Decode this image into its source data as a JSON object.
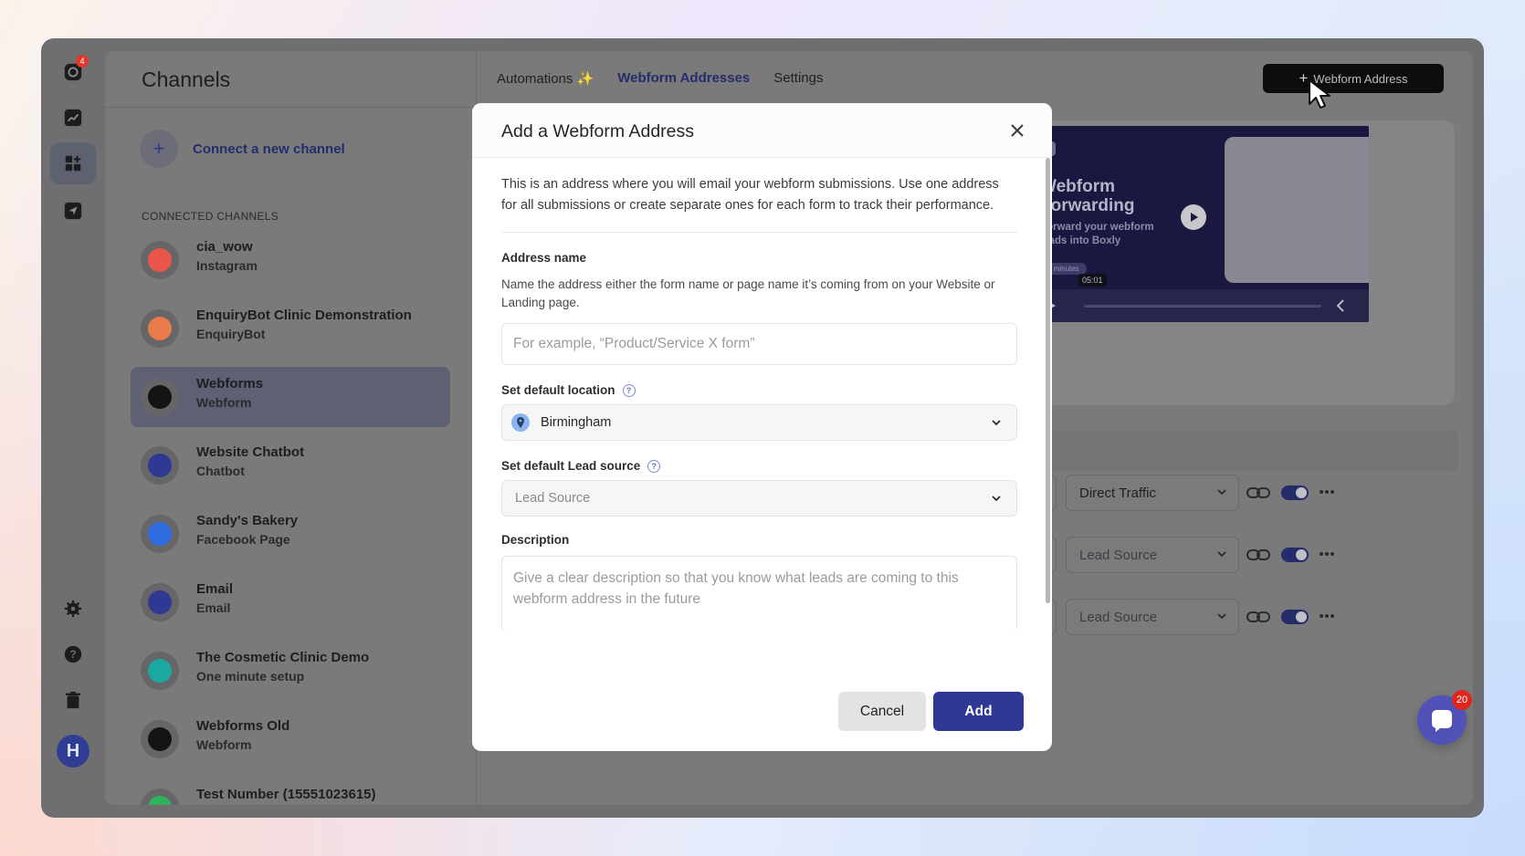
{
  "rail": {
    "badge": "4",
    "avatar_initial": "H"
  },
  "channels": {
    "title": "Channels",
    "connect_label": "Connect a new channel",
    "section_label": "CONNECTED CHANNELS",
    "items": [
      {
        "name": "cia_wow",
        "type": "Instagram",
        "color": "#e8574a"
      },
      {
        "name": "EnquiryBot Clinic Demonstration",
        "type": "EnquiryBot",
        "color": "#e97a4a"
      },
      {
        "name": "Webforms",
        "type": "Webform",
        "color": "#141416"
      },
      {
        "name": "Website Chatbot",
        "type": "Chatbot",
        "color": "#2f3893"
      },
      {
        "name": "Sandy's Bakery",
        "type": "Facebook Page",
        "color": "#2f6ce0"
      },
      {
        "name": "Email",
        "type": "Email",
        "color": "#2f3893"
      },
      {
        "name": "The Cosmetic Clinic Demo",
        "type": "One minute setup",
        "color": "#1aa8a0"
      },
      {
        "name": "Webforms Old",
        "type": "Webform",
        "color": "#141416"
      },
      {
        "name": "Test Number (15551023615)",
        "type": "",
        "color": "#2fb35a"
      }
    ]
  },
  "tabs": {
    "automations": "Automations ✨",
    "webform_addresses": "Webform Addresses",
    "settings": "Settings"
  },
  "top_button": "Webform Address",
  "video": {
    "title_line1": "Webform",
    "title_line2": "Forwarding",
    "subtitle_line1": "Forward your webform",
    "subtitle_line2": "leads into Boxly",
    "timestamp": "05:01",
    "duration_chip": "5 minutes"
  },
  "rows": [
    {
      "lead_source": "Direct Traffic",
      "muted": false
    },
    {
      "lead_source": "Lead Source",
      "muted": true
    },
    {
      "lead_source": "Lead Source",
      "muted": true
    }
  ],
  "chat": {
    "badge": "20"
  },
  "modal": {
    "title": "Add a Webform Address",
    "intro": "This is an address where you will email your webform submissions. Use one address for all submissions or create separate ones for each form to track their performance.",
    "address_name_label": "Address name",
    "address_name_desc": "Name the address either the form name or page name it’s coming from on your Website or Landing page.",
    "address_name_placeholder": "For example, “Product/Service X form”",
    "location_label": "Set default location",
    "location_value": "Birmingham",
    "lead_source_label": "Set default Lead source",
    "lead_source_placeholder": "Lead Source",
    "description_label": "Description",
    "description_placeholder": "Give a clear description so that you know what leads are coming to this webform address in the future",
    "cancel_label": "Cancel",
    "add_label": "Add"
  }
}
